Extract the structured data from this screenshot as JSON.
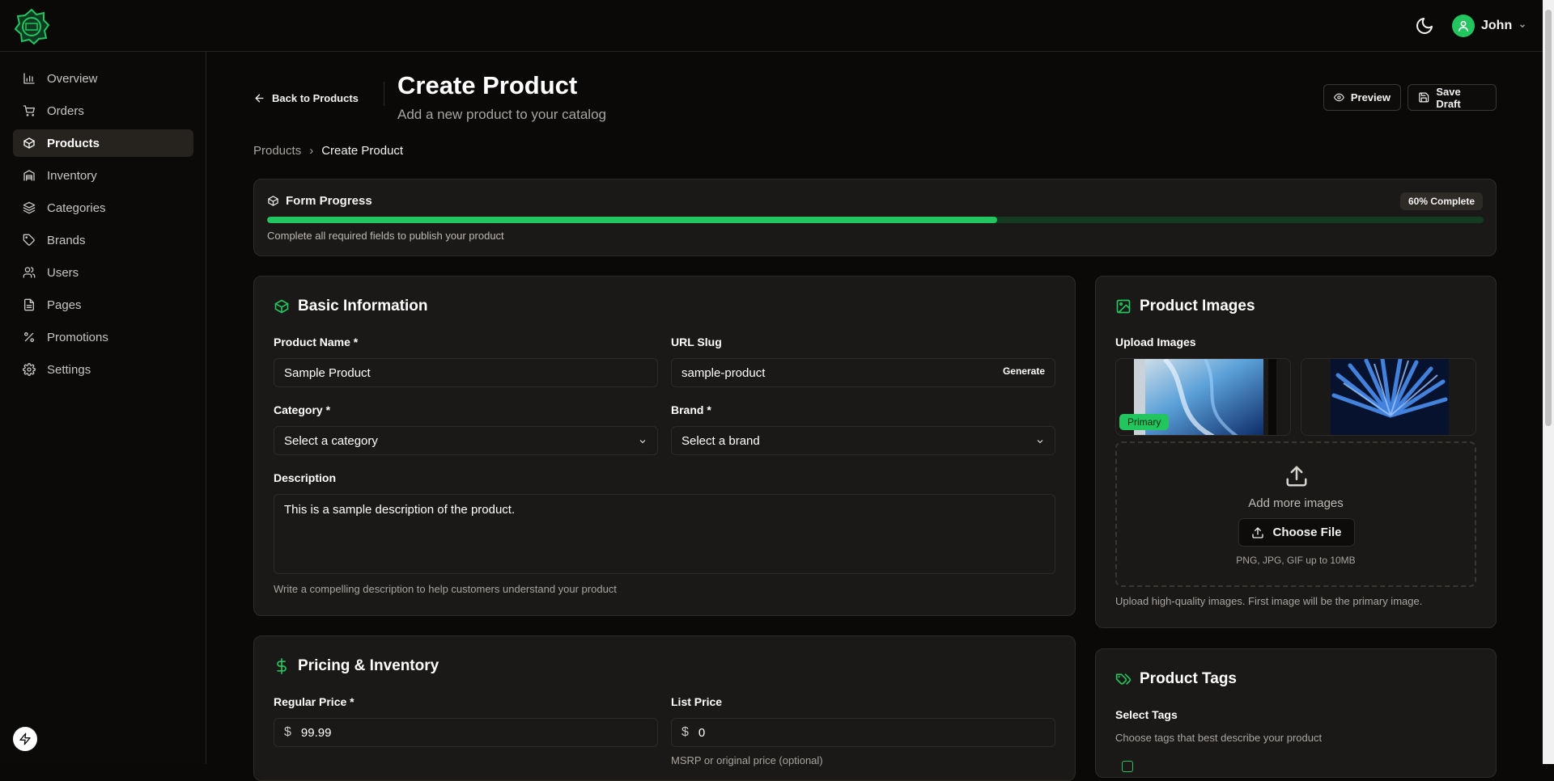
{
  "header": {
    "user_name": "John",
    "brand_color": "#22c55e"
  },
  "sidebar": {
    "items": [
      {
        "label": "Overview",
        "icon": "bar-chart-icon"
      },
      {
        "label": "Orders",
        "icon": "cart-icon"
      },
      {
        "label": "Products",
        "icon": "package-icon",
        "active": true
      },
      {
        "label": "Inventory",
        "icon": "warehouse-icon"
      },
      {
        "label": "Categories",
        "icon": "layers-icon"
      },
      {
        "label": "Brands",
        "icon": "tag-icon"
      },
      {
        "label": "Users",
        "icon": "users-icon"
      },
      {
        "label": "Pages",
        "icon": "file-icon"
      },
      {
        "label": "Promotions",
        "icon": "percent-icon"
      },
      {
        "label": "Settings",
        "icon": "gear-icon"
      }
    ]
  },
  "page": {
    "back_label": "Back to Products",
    "title": "Create Product",
    "subtitle": "Add a new product to your catalog",
    "preview_label": "Preview",
    "save_draft_label": "Save Draft",
    "breadcrumb": {
      "parent": "Products",
      "separator": "›",
      "current": "Create Product"
    }
  },
  "progress": {
    "title": "Form Progress",
    "badge": "60% Complete",
    "percent": 60,
    "hint": "Complete all required fields to publish your product"
  },
  "basic": {
    "title": "Basic Information",
    "product_name_label": "Product Name *",
    "product_name_value": "Sample Product",
    "slug_label": "URL Slug",
    "slug_value": "sample-product",
    "generate_label": "Generate",
    "category_label": "Category *",
    "category_value": "Select a category",
    "brand_label": "Brand *",
    "brand_value": "Select a brand",
    "description_label": "Description",
    "description_value": "This is a sample description of the product.",
    "description_hint": "Write a compelling description to help customers understand your product"
  },
  "pricing": {
    "title": "Pricing & Inventory",
    "regular_label": "Regular Price *",
    "regular_value": "99.99",
    "list_label": "List Price",
    "list_value": "0",
    "currency": "$",
    "list_hint": "MSRP or original price (optional)"
  },
  "images": {
    "title": "Product Images",
    "upload_label": "Upload Images",
    "primary_badge": "Primary",
    "add_more": "Add more images",
    "choose_file": "Choose File",
    "formats": "PNG, JPG, GIF up to 10MB",
    "hint": "Upload high-quality images. First image will be the primary image."
  },
  "tags": {
    "title": "Product Tags",
    "select_label": "Select Tags",
    "hint": "Choose tags that best describe your product"
  }
}
